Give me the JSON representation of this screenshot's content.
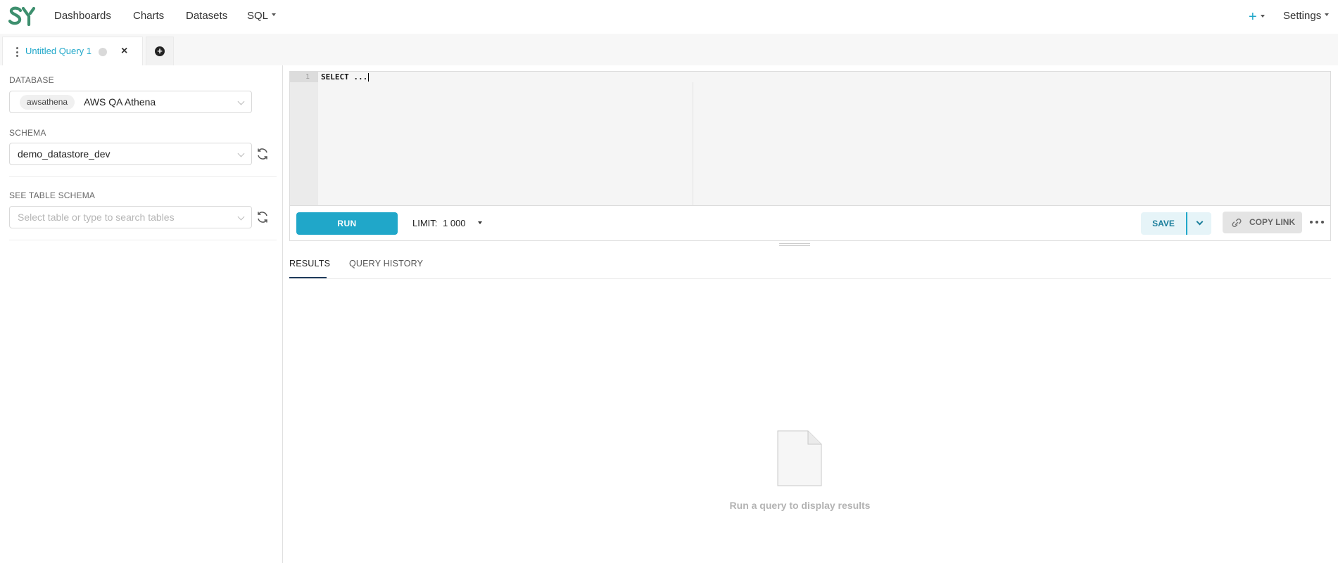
{
  "navbar": {
    "logo_alt": "SY",
    "links": [
      "Dashboards",
      "Charts",
      "Datasets",
      "SQL"
    ],
    "plus_label": "+",
    "settings_label": "Settings"
  },
  "tabs": {
    "active_title": "Untitled Query 1",
    "close_label": "×",
    "add_label": "+"
  },
  "sidebar": {
    "database_label": "DATABASE",
    "database_tag": "awsathena",
    "database_name": "AWS QA Athena",
    "schema_label": "SCHEMA",
    "schema_value": "demo_datastore_dev",
    "table_schema_label": "SEE TABLE SCHEMA",
    "table_placeholder": "Select table or type to search tables"
  },
  "editor": {
    "line_number": "1",
    "code": "SELECT ..."
  },
  "toolbar": {
    "run_label": "RUN",
    "limit_label": "LIMIT:",
    "limit_value": "1 000",
    "save_label": "SAVE",
    "copy_link_label": "COPY LINK"
  },
  "results": {
    "tabs": [
      "RESULTS",
      "QUERY HISTORY"
    ],
    "empty_message": "Run a query to display results"
  },
  "colors": {
    "accent": "#20a7c9",
    "logo": "#3d8f6e",
    "tab_underline": "#1f3b5c"
  }
}
